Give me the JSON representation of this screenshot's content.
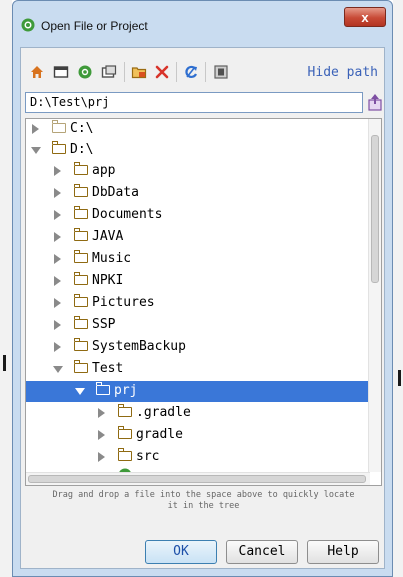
{
  "window": {
    "title": "Open File or Project",
    "close_label": "x"
  },
  "toolbar": {
    "icons": [
      "home-icon",
      "desktop-icon",
      "project-icon",
      "module-icon",
      "new-folder-icon",
      "delete-icon",
      "refresh-icon",
      "show-hidden-icon"
    ],
    "hide_path_label": "Hide path"
  },
  "path": {
    "value": "D:\\Test\\prj"
  },
  "tree": {
    "items": [
      {
        "label": "C:\\"
      },
      {
        "label": "D:\\"
      },
      {
        "label": "app"
      },
      {
        "label": "DbData"
      },
      {
        "label": "Documents"
      },
      {
        "label": "JAVA"
      },
      {
        "label": "Music"
      },
      {
        "label": "NPKI"
      },
      {
        "label": "Pictures"
      },
      {
        "label": "SSP"
      },
      {
        "label": "SystemBackup"
      },
      {
        "label": "Test"
      },
      {
        "label": "prj"
      },
      {
        "label": ".gradle"
      },
      {
        "label": "gradle"
      },
      {
        "label": "src"
      }
    ]
  },
  "hint": {
    "line1": "Drag and drop a file into the space above to quickly locate",
    "line2": "it in the tree"
  },
  "buttons": {
    "ok": "OK",
    "cancel": "Cancel",
    "help": "Help"
  },
  "colors": {
    "selection": "#3a77d8",
    "link": "#3b62b8",
    "folder": "#8f6a12"
  }
}
